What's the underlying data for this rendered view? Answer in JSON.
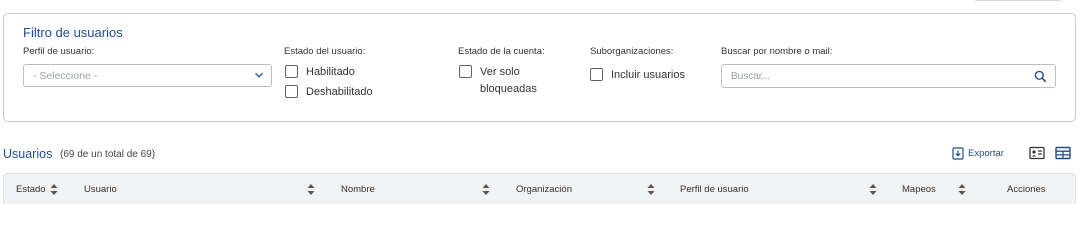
{
  "filter": {
    "title": "Filtro de usuarios",
    "perfil": {
      "label": "Perfil de usuario:",
      "value": "- Seleccione -"
    },
    "estado_usuario": {
      "label": "Estado del usuario:",
      "options": [
        "Habilitado",
        "Deshabilitado"
      ]
    },
    "estado_cuenta": {
      "label": "Estado de la cuenta:",
      "option_line1": "Ver solo",
      "option_line2": "bloqueadas"
    },
    "suborganizaciones": {
      "label": "Suborganizaciones:",
      "option": "Incluir usuarios"
    },
    "buscar": {
      "label": "Buscar por nombre o mail:",
      "placeholder": "Buscar..."
    }
  },
  "users": {
    "title": "Usuarios",
    "count": "(69 de un total de 69)",
    "export_label": "Exportar"
  },
  "table": {
    "columns": [
      "Estado",
      "Usuario",
      "Nombre",
      "Organización",
      "Perfil de usuario",
      "Mapeos",
      "Acciones"
    ]
  },
  "colors": {
    "accent": "#1f4e8c",
    "header_bg": "#f1f2f4",
    "border": "#c9cdd3"
  }
}
